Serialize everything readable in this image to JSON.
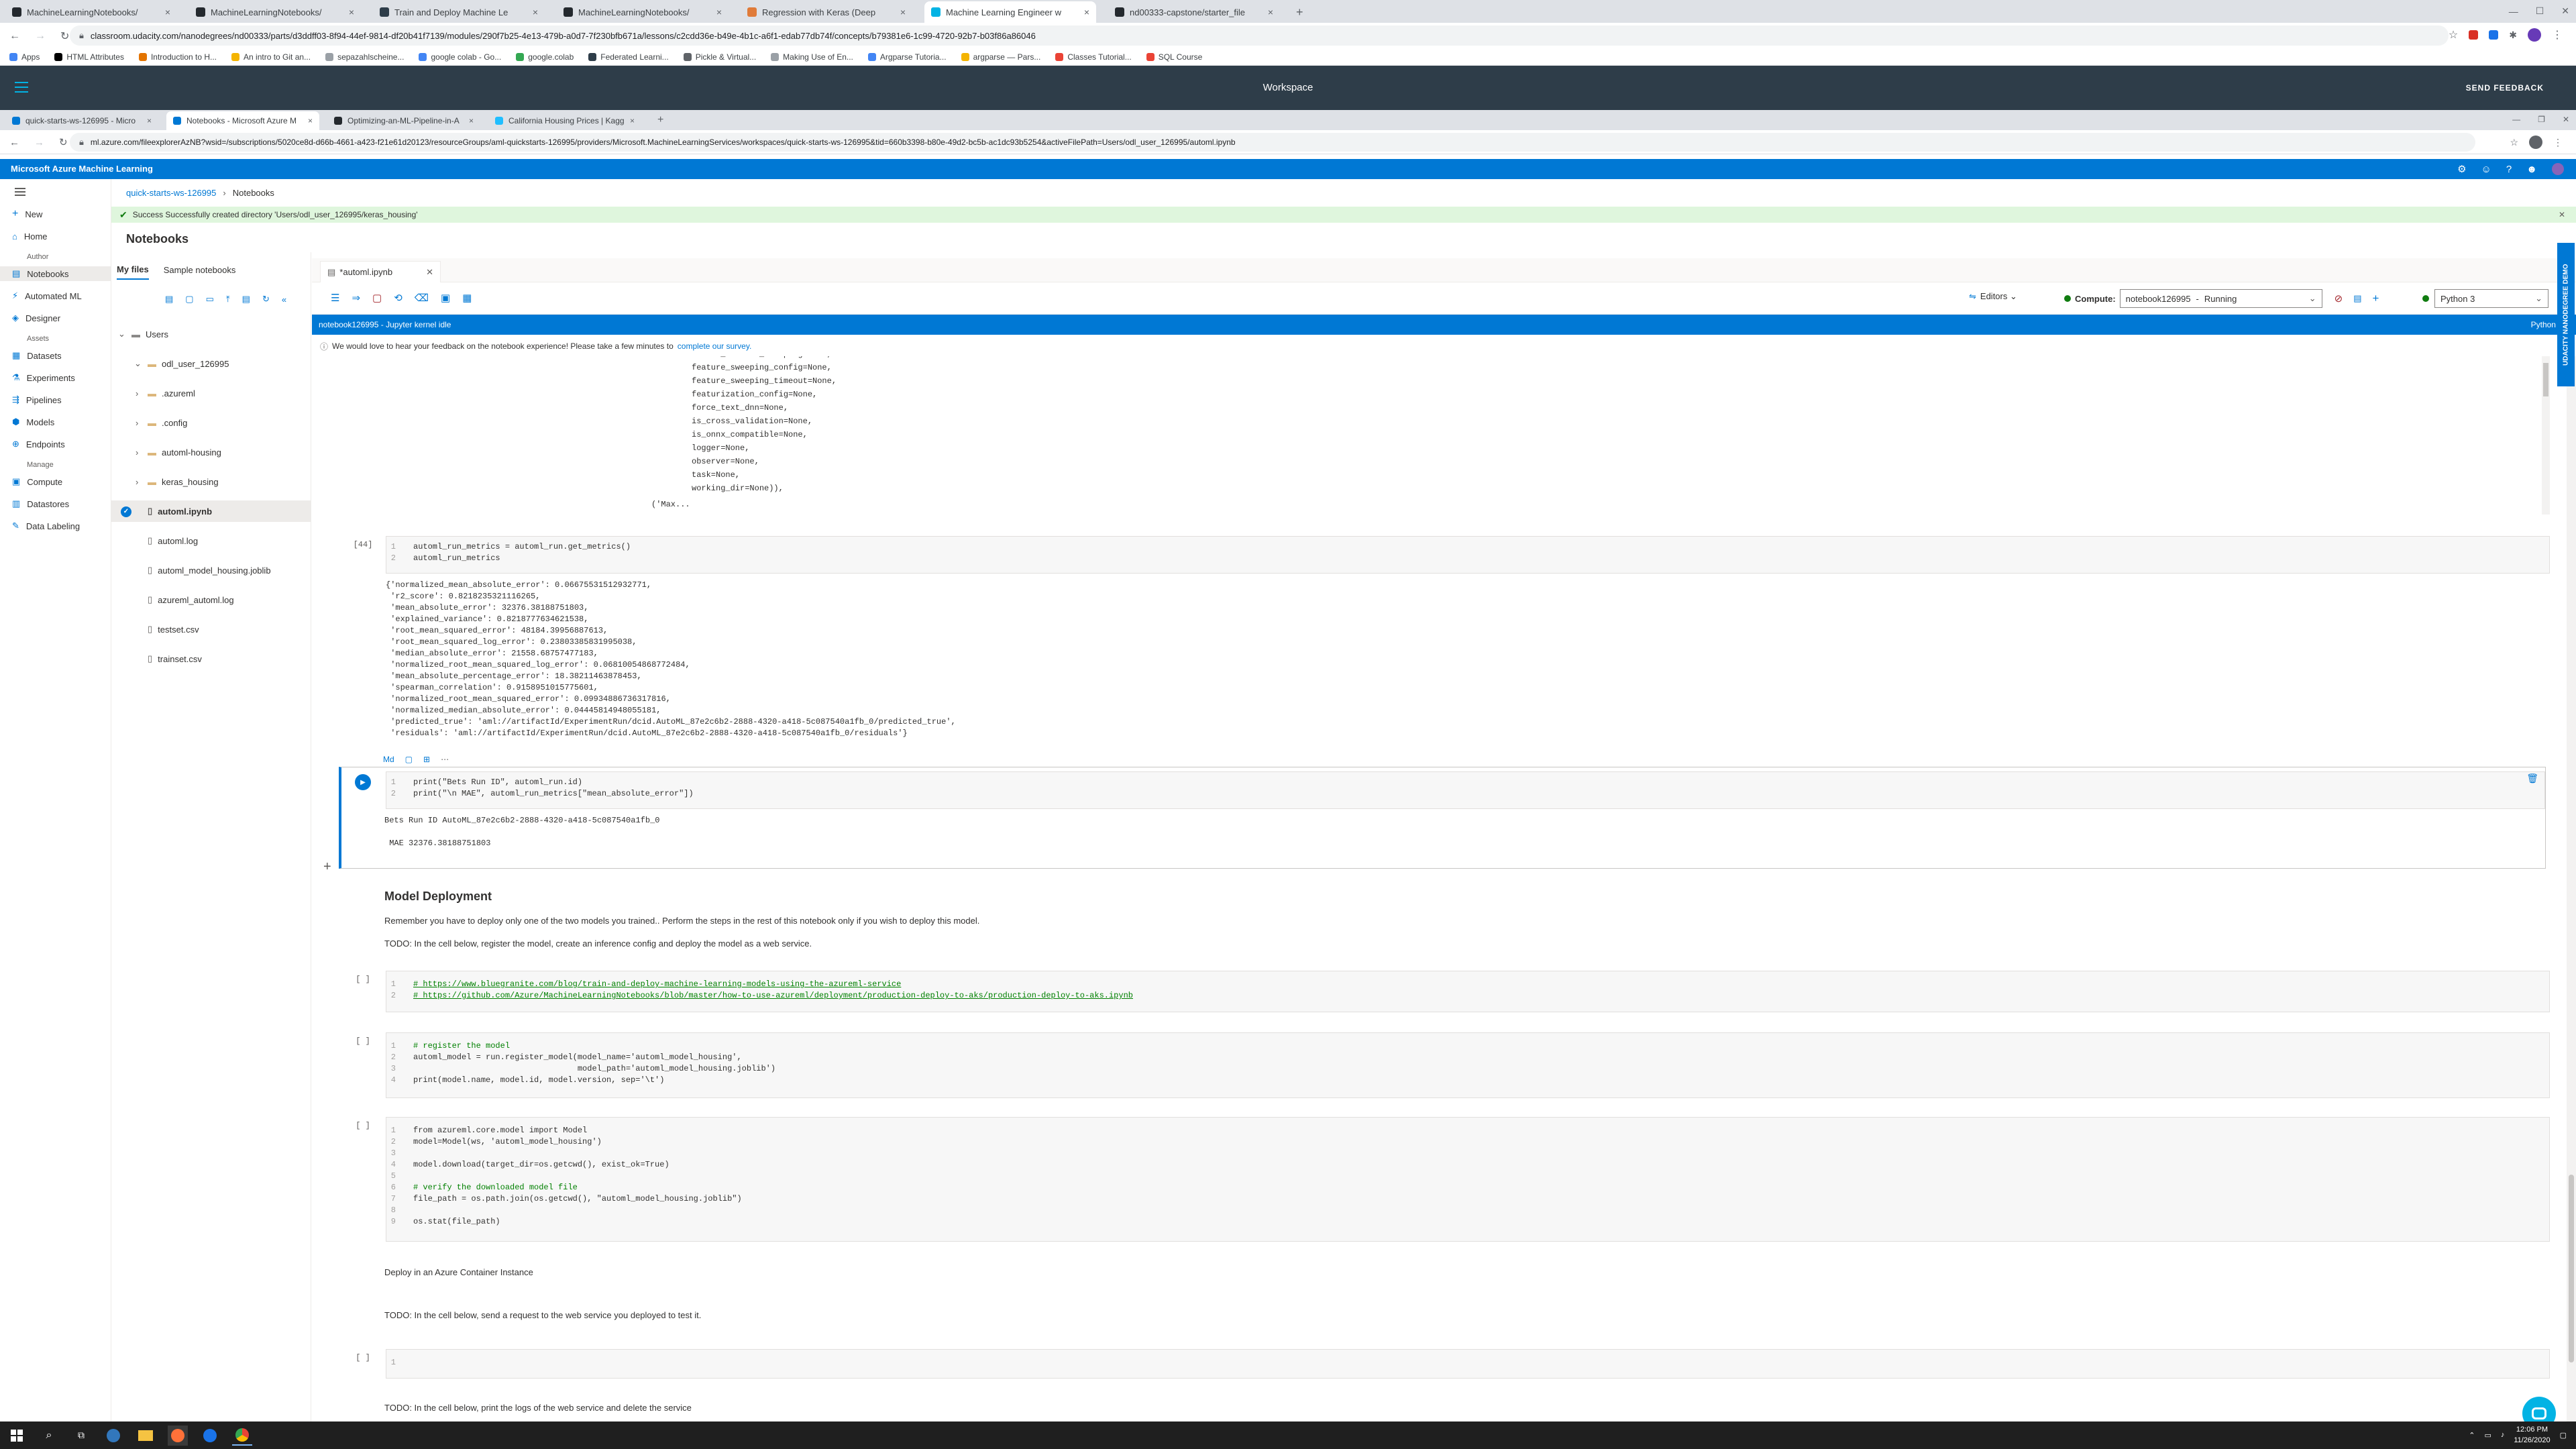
{
  "outer_tabs": [
    {
      "label": "MachineLearningNotebooks/",
      "color": "#24292e"
    },
    {
      "label": "MachineLearningNotebooks/",
      "color": "#24292e"
    },
    {
      "label": "Train and Deploy Machine Le",
      "color": "#2e3d49"
    },
    {
      "label": "MachineLearningNotebooks/",
      "color": "#24292e"
    },
    {
      "label": "Regression with Keras (Deep",
      "color": "#e07b39"
    },
    {
      "label": "Machine Learning Engineer w",
      "color": "#02b3e4"
    },
    {
      "label": "nd00333-capstone/starter_file",
      "color": "#24292e"
    }
  ],
  "outer_url": "classroom.udacity.com/nanodegrees/nd00333/parts/d3ddff03-8f94-44ef-9814-df20b41f7139/modules/290f7b25-4e13-479b-a0d7-7f230bfb671a/lessons/c2cdd36e-b49e-4b1c-a6f1-edab77db74f/concepts/b79381e6-1c99-4720-92b7-b03f86a86046",
  "bookmarks": [
    {
      "label": "Apps",
      "color": "#4285f4"
    },
    {
      "label": "HTML Attributes",
      "color": "#000000"
    },
    {
      "label": "Introduction to H...",
      "color": "#e37400"
    },
    {
      "label": "An intro to Git an...",
      "color": "#f4b400"
    },
    {
      "label": "sepazahlscheine...",
      "color": "#9aa0a6"
    },
    {
      "label": "google colab - Go...",
      "color": "#4285f4"
    },
    {
      "label": "google.colab",
      "color": "#34a853"
    },
    {
      "label": "Federated Learni...",
      "color": "#2e3d49"
    },
    {
      "label": "Pickle & Virtual...",
      "color": "#5f6368"
    },
    {
      "label": "Making Use of En...",
      "color": "#9aa0a6"
    },
    {
      "label": "Argparse Tutoria...",
      "color": "#4285f4"
    },
    {
      "label": "argparse — Pars...",
      "color": "#f4b400"
    },
    {
      "label": "Classes Tutorial...",
      "color": "#ea4335"
    },
    {
      "label": "SQL Course",
      "color": "#ea4335"
    }
  ],
  "udacity": {
    "title": "Workspace",
    "feedback": "SEND FEEDBACK"
  },
  "inner_tabs": [
    {
      "label": "quick-starts-ws-126995 - Micro",
      "color": "#0078d4"
    },
    {
      "label": "Notebooks - Microsoft Azure M",
      "color": "#0078d4"
    },
    {
      "label": "Optimizing-an-ML-Pipeline-in-A",
      "color": "#24292e"
    },
    {
      "label": "California Housing Prices | Kagg",
      "color": "#20beff"
    }
  ],
  "inner_url": "ml.azure.com/fileexplorerAzNB?wsid=/subscriptions/5020ce8d-d66b-4661-a423-f21e61d20123/resourceGroups/aml-quickstarts-126995/providers/Microsoft.MachineLearningServices/workspaces/quick-starts-ws-126995&tid=660b3398-b80e-49d2-bc5b-ac1dc93b5254&activeFilePath=Users/odl_user_126995/automl.ipynb",
  "azure_title": "Microsoft Azure Machine Learning",
  "nav": {
    "new": "New",
    "home": "Home",
    "section_author": "Author",
    "notebooks": "Notebooks",
    "automated_ml": "Automated ML",
    "designer": "Designer",
    "section_assets": "Assets",
    "datasets": "Datasets",
    "experiments": "Experiments",
    "pipelines": "Pipelines",
    "models": "Models",
    "endpoints": "Endpoints",
    "section_manage": "Manage",
    "compute": "Compute",
    "datastores": "Datastores",
    "data_labeling": "Data Labeling"
  },
  "breadcrumb": {
    "workspace": "quick-starts-ws-126995",
    "current": "Notebooks"
  },
  "success": {
    "text": "Success Successfully created directory 'Users/odl_user_126995/keras_housing'"
  },
  "page_title": "Notebooks",
  "file_tabs": {
    "my_files": "My files",
    "sample": "Sample notebooks"
  },
  "files": {
    "users": "Users",
    "user_dir": "odl_user_126995",
    "items": [
      {
        "name": ".azureml",
        "type": "folder"
      },
      {
        "name": ".config",
        "type": "folder"
      },
      {
        "name": "automl-housing",
        "type": "folder"
      },
      {
        "name": "keras_housing",
        "type": "folder"
      },
      {
        "name": "automl.ipynb",
        "type": "notebook"
      },
      {
        "name": "automl.log",
        "type": "file"
      },
      {
        "name": "automl_model_housing.joblib",
        "type": "file"
      },
      {
        "name": "azureml_automl.log",
        "type": "file"
      },
      {
        "name": "testset.csv",
        "type": "file"
      },
      {
        "name": "trainset.csv",
        "type": "file"
      }
    ]
  },
  "notebook_tab": "*automl.ipynb",
  "toolbar": {
    "editors": "Editors",
    "compute_label": "Compute:",
    "compute_value": "notebook126995",
    "compute_sep": "-",
    "compute_status": "Running",
    "kernel": "Python 3"
  },
  "kernel_bar": {
    "left": "notebook126995 - Jupyter kernel idle",
    "right": "Python 3.6"
  },
  "survey": {
    "text": "We would love to hear your feedback on the notebook experience! Please take a few minutes to",
    "link": "complete our survey."
  },
  "scrolled_output": [
    "enable_feature_sweeping=None,",
    "feature_sweeping_config=None,",
    "feature_sweeping_timeout=None,",
    "featurization_config=None,",
    "force_text_dnn=None,",
    "is_cross_validation=None,",
    "is_onnx_compatible=None,",
    "logger=None,",
    "observer=None,",
    "task=None,",
    "working_dir=None)),"
  ],
  "scrolled_output_tail": "('Max...",
  "cell44": {
    "exec": "[44]",
    "code": [
      "automl_run_metrics = automl_run.get_metrics()",
      "automl_run_metrics"
    ],
    "output": [
      "{'normalized_mean_absolute_error': 0.06675531512932771,",
      " 'r2_score': 0.8218235321116265,",
      " 'mean_absolute_error': 32376.38188751803,",
      " 'explained_variance': 0.8218777634621538,",
      " 'root_mean_squared_error': 48184.39956887613,",
      " 'root_mean_squared_log_error': 0.23803385831995038,",
      " 'median_absolute_error': 21558.68757477183,",
      " 'normalized_root_mean_squared_log_error': 0.06810054868772484,",
      " 'mean_absolute_percentage_error': 18.38211463878453,",
      " 'spearman_correlation': 0.9158951015775601,",
      " 'normalized_root_mean_squared_error': 0.09934886736317816,",
      " 'normalized_median_absolute_error': 0.04445814948055181,",
      " 'predicted_true': 'aml://artifactId/ExperimentRun/dcid.AutoML_87e2c6b2-2888-4320-a418-5c087540a1fb_0/predicted_true',",
      " 'residuals': 'aml://artifactId/ExperimentRun/dcid.AutoML_87e2c6b2-2888-4320-a418-5c087540a1fb_0/residuals'}"
    ]
  },
  "cell_current": {
    "md_label": "Md",
    "code": [
      "print(\"Bets Run ID\", automl_run.id)",
      "print(\"\\n MAE\", automl_run_metrics[\"mean_absolute_error\"])"
    ],
    "output": [
      "Bets Run ID AutoML_87e2c6b2-2888-4320-a418-5c087540a1fb_0",
      "",
      " MAE 32376.38188751803"
    ]
  },
  "deploy": {
    "heading": "Model Deployment",
    "p1": "Remember you have to deploy only one of the two models you trained.. Perform the steps in the rest of this notebook only if you wish to deploy this model.",
    "p2": "TODO: In the cell below, register the model, create an inference config and deploy the model as a web service."
  },
  "cell_links": {
    "exec": "[ ]",
    "code": [
      "# https://www.bluegranite.com/blog/train-and-deploy-machine-learning-models-using-the-azureml-service",
      "# https://github.com/Azure/MachineLearningNotebooks/blob/master/how-to-use-azureml/deployment/production-deploy-to-aks/production-deploy-to-aks.ipynb"
    ]
  },
  "cell_register": {
    "exec": "[ ]",
    "code": [
      "# register the model",
      "automl_model = run.register_model(model_name='automl_model_housing',",
      "                                  model_path='automl_model_housing.joblib')",
      "print(model.name, model.id, model.version, sep='\\t')"
    ]
  },
  "cell_download": {
    "exec": "[ ]",
    "code": [
      "from azureml.core.model import Model",
      "model=Model(ws, 'automl_model_housing')",
      "",
      "model.download(target_dir=os.getcwd(), exist_ok=True)",
      "",
      "# verify the downloaded model file",
      "file_path = os.path.join(os.getcwd(), \"automl_model_housing.joblib\")",
      "",
      "os.stat(file_path)"
    ]
  },
  "md_aci": "Deploy in an Azure Container Instance",
  "md_todo_request": "TODO: In the cell below, send a request to the web service you deployed to test it.",
  "cell_empty": {
    "exec": "[ ]",
    "line": "1"
  },
  "md_todo_logs": "TODO: In the cell below, print the logs of the web service and delete the service",
  "side_tab": "UDACITY NANODEGREE DEMO",
  "clock": {
    "time": "12:06 PM",
    "date": "11/26/2020"
  }
}
